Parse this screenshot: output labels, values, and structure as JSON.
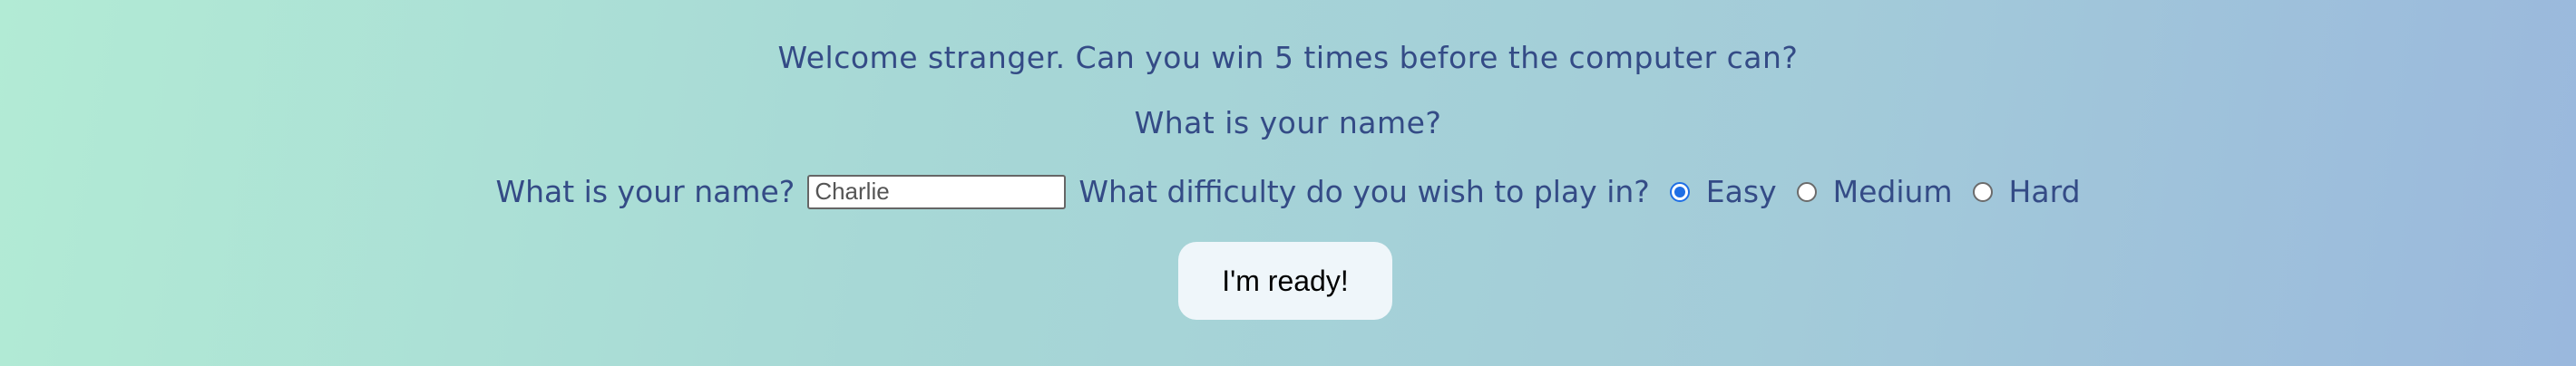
{
  "intro": {
    "welcome": "Welcome stranger. Can you win 5 times before the computer can?",
    "name_question": "What is your name?"
  },
  "form": {
    "name_label": "What is your name?",
    "name_value": "Charlie",
    "difficulty_label": "What difficulty do you wish to play in?",
    "difficulty_options": [
      {
        "label": "Easy",
        "selected": true
      },
      {
        "label": "Medium",
        "selected": false
      },
      {
        "label": "Hard",
        "selected": false
      }
    ]
  },
  "ready_button": {
    "label": "I'm ready!"
  },
  "colors": {
    "text": "#344b86",
    "radio_selected": "#1f6fe5",
    "button_bg": "#eff6fa"
  }
}
